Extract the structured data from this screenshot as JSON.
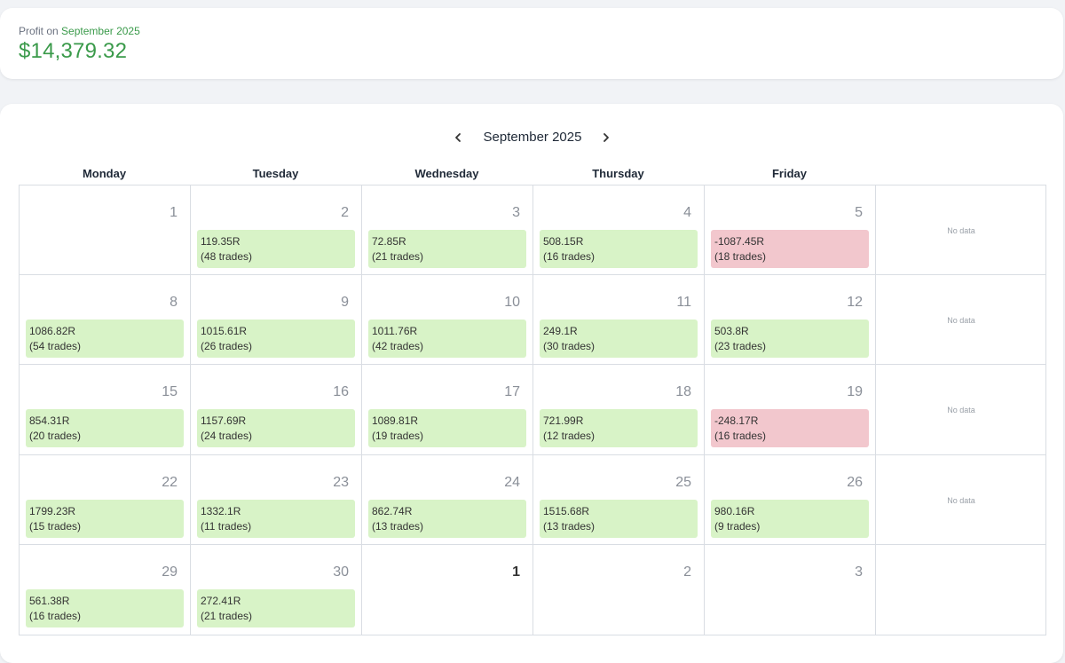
{
  "summary": {
    "label_prefix": "Profit on",
    "label_month": "September 2025",
    "amount": "$14,379.32"
  },
  "calendar": {
    "month_title": "September 2025",
    "weekdays": [
      "Monday",
      "Tuesday",
      "Wednesday",
      "Thursday",
      "Friday"
    ],
    "no_data_label": "No data",
    "weeks": [
      {
        "days": [
          {
            "day": "1",
            "pnl": "",
            "trades": ""
          },
          {
            "day": "2",
            "pnl": "119.35R",
            "trades": "(48 trades)",
            "type": "win"
          },
          {
            "day": "3",
            "pnl": "72.85R",
            "trades": "(21 trades)",
            "type": "win"
          },
          {
            "day": "4",
            "pnl": "508.15R",
            "trades": "(16 trades)",
            "type": "win"
          },
          {
            "day": "5",
            "pnl": "-1087.45R",
            "trades": "(18 trades)",
            "type": "loss"
          }
        ],
        "weekend": "No data"
      },
      {
        "days": [
          {
            "day": "8",
            "pnl": "1086.82R",
            "trades": "(54 trades)",
            "type": "win"
          },
          {
            "day": "9",
            "pnl": "1015.61R",
            "trades": "(26 trades)",
            "type": "win"
          },
          {
            "day": "10",
            "pnl": "1011.76R",
            "trades": "(42 trades)",
            "type": "win"
          },
          {
            "day": "11",
            "pnl": "249.1R",
            "trades": "(30 trades)",
            "type": "win"
          },
          {
            "day": "12",
            "pnl": "503.8R",
            "trades": "(23 trades)",
            "type": "win"
          }
        ],
        "weekend": "No data"
      },
      {
        "days": [
          {
            "day": "15",
            "pnl": "854.31R",
            "trades": "(20 trades)",
            "type": "win"
          },
          {
            "day": "16",
            "pnl": "1157.69R",
            "trades": "(24 trades)",
            "type": "win"
          },
          {
            "day": "17",
            "pnl": "1089.81R",
            "trades": "(19 trades)",
            "type": "win"
          },
          {
            "day": "18",
            "pnl": "721.99R",
            "trades": "(12 trades)",
            "type": "win"
          },
          {
            "day": "19",
            "pnl": "-248.17R",
            "trades": "(16 trades)",
            "type": "loss"
          }
        ],
        "weekend": "No data"
      },
      {
        "days": [
          {
            "day": "22",
            "pnl": "1799.23R",
            "trades": "(15 trades)",
            "type": "win"
          },
          {
            "day": "23",
            "pnl": "1332.1R",
            "trades": "(11 trades)",
            "type": "win"
          },
          {
            "day": "24",
            "pnl": "862.74R",
            "trades": "(13 trades)",
            "type": "win"
          },
          {
            "day": "25",
            "pnl": "1515.68R",
            "trades": "(13 trades)",
            "type": "win"
          },
          {
            "day": "26",
            "pnl": "980.16R",
            "trades": "(9 trades)",
            "type": "win"
          }
        ],
        "weekend": "No data"
      },
      {
        "days": [
          {
            "day": "29",
            "pnl": "561.38R",
            "trades": "(16 trades)",
            "type": "win"
          },
          {
            "day": "30",
            "pnl": "272.41R",
            "trades": "(21 trades)",
            "type": "win"
          },
          {
            "day": "1",
            "pnl": "",
            "trades": "",
            "next_month": true
          },
          {
            "day": "2",
            "pnl": "",
            "trades": ""
          },
          {
            "day": "3",
            "pnl": "",
            "trades": ""
          }
        ],
        "weekend": ""
      }
    ]
  },
  "icons": {
    "prev": "chevron-left-icon",
    "next": "chevron-right-icon"
  },
  "colors": {
    "profit_green": "#3a9a4a",
    "win_bg": "#d8f3c7",
    "loss_bg": "#f2c7cd"
  }
}
